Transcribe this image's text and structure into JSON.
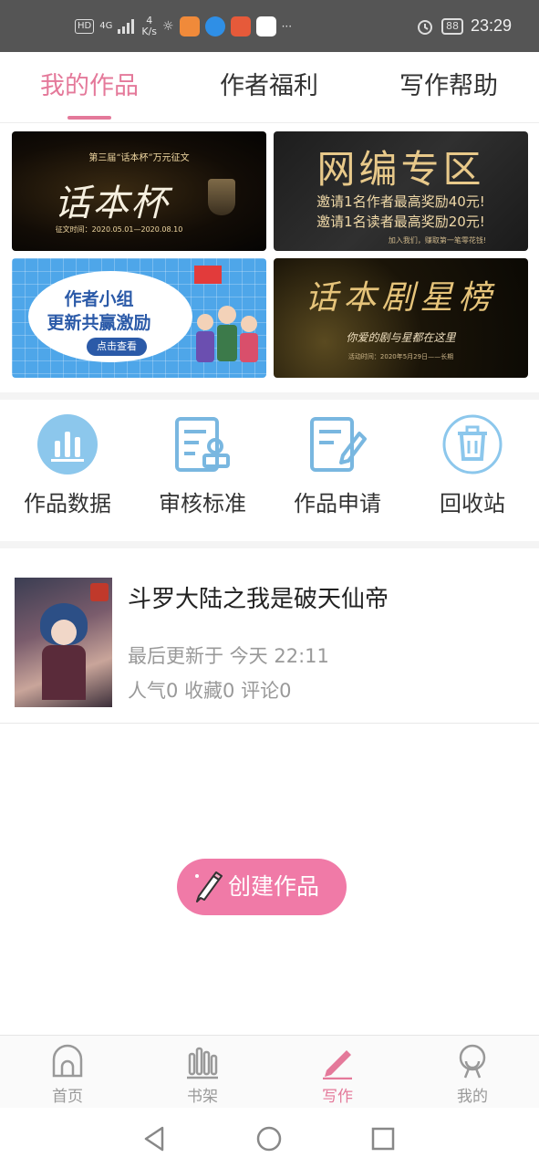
{
  "status_bar": {
    "hd": "HD",
    "network": "4G",
    "speed_value": "4",
    "speed_unit": "K/s",
    "battery": "88",
    "time": "23:29",
    "more": "···",
    "icons": [
      "signal-icon",
      "brightness-icon",
      "app-icon-1",
      "app-icon-2",
      "app-icon-3",
      "app-icon-4",
      "alarm-icon",
      "battery-icon"
    ]
  },
  "top_tabs": [
    {
      "label": "我的作品",
      "active": true
    },
    {
      "label": "作者福利",
      "active": false
    },
    {
      "label": "写作帮助",
      "active": false
    }
  ],
  "banners": {
    "b1": {
      "sub": "第三届“话本杯”万元征文",
      "title": "话本杯",
      "caption": "征文时间：2020.05.01—2020.08.10"
    },
    "b2": {
      "title": "网编专区",
      "line1": "邀请1名作者最高奖励40元!",
      "line2": "邀请1名读者最高奖励20元!",
      "line3": "加入我们，赚取第一笔零花钱!"
    },
    "b3": {
      "line1": "作者小组",
      "line2": "更新共赢激励",
      "button": "点击查看"
    },
    "b4": {
      "title": "话本剧星榜",
      "line1": "你爱的剧与星都在这里",
      "line2": "活动时间：2020年5月29日——长期"
    }
  },
  "tools": [
    {
      "label": "作品数据",
      "icon": "chart-icon"
    },
    {
      "label": "审核标准",
      "icon": "review-icon"
    },
    {
      "label": "作品申请",
      "icon": "apply-icon"
    },
    {
      "label": "回收站",
      "icon": "trash-icon"
    }
  ],
  "work": {
    "title": "斗罗大陆之我是破天仙帝",
    "updated": "最后更新于 今天 22:11",
    "stats": "人气0 收藏0 评论0"
  },
  "create_button": {
    "label": "创建作品"
  },
  "bottom_nav": [
    {
      "label": "首页",
      "icon": "home-icon",
      "active": false
    },
    {
      "label": "书架",
      "icon": "bookshelf-icon",
      "active": false
    },
    {
      "label": "写作",
      "icon": "pencil-icon",
      "active": true
    },
    {
      "label": "我的",
      "icon": "profile-icon",
      "active": false
    }
  ],
  "system_nav": [
    "back-icon",
    "home-circle-icon",
    "recents-icon"
  ],
  "colors": {
    "accent": "#e4799a",
    "create_button": "#f07aa7",
    "tool_icon": "#79b7e0",
    "status_bar": "#555555"
  }
}
